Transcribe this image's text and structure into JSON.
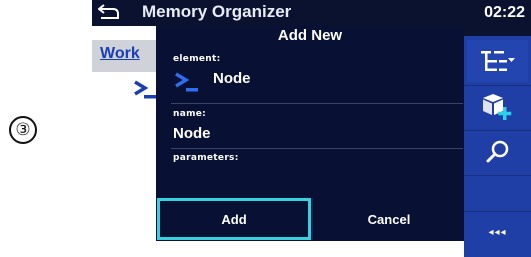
{
  "step_marker": "③",
  "app": {
    "title": "Memory Organizer",
    "clock": "02:22"
  },
  "background": {
    "tab_label": "Work"
  },
  "dialog": {
    "title": "Add New",
    "element_label": "element:",
    "element_value": "Node",
    "element_icon": "node-prompt-icon",
    "name_label": "name:",
    "name_value": "Node",
    "parameters_label": "parameters:",
    "parameters_value": "",
    "add_label": "Add",
    "cancel_label": "Cancel"
  },
  "toolbar": {
    "items": [
      "tree-structure-icon",
      "add-object-icon",
      "search-icon",
      "more-options-icon"
    ],
    "more_label": "◂◂◂"
  },
  "colors": {
    "dialog_bg": "#081033",
    "topbar_bg": "#0b1230",
    "toolbar_bg": "#1f3fa6",
    "focus_border": "#35d1e0",
    "accent_blue": "#1a3fb3",
    "add_plus": "#2ad1e8"
  }
}
